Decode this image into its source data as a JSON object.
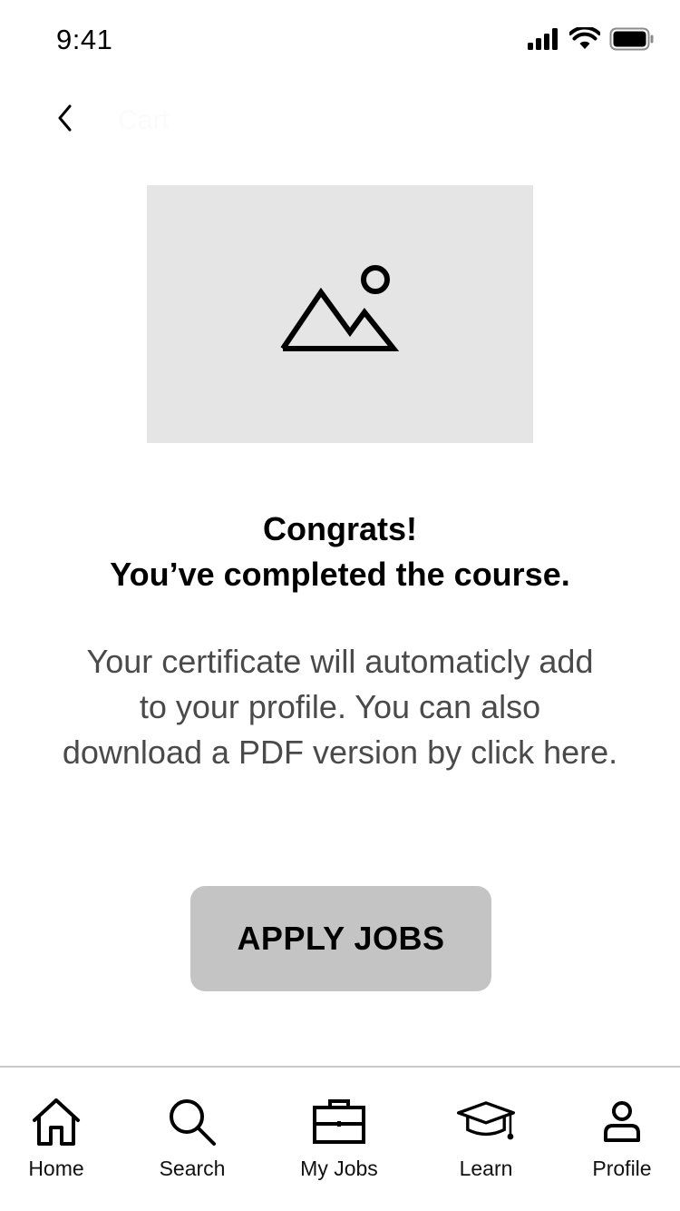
{
  "status_bar": {
    "time": "9:41",
    "icons": [
      "cellular-signal-icon",
      "wifi-icon",
      "battery-icon"
    ]
  },
  "nav": {
    "back_icon": "chevron-left-icon",
    "title": "Cart"
  },
  "hero": {
    "icon": "image-placeholder-icon"
  },
  "content": {
    "headline_line1": "Congrats!",
    "headline_line2": "You’ve completed the course.",
    "body_line1": "Your certificate will automaticly add",
    "body_line2": "to your profile. You can also",
    "body_line3": "download a PDF version by click here."
  },
  "cta": {
    "label": "APPLY JOBS"
  },
  "tab_bar": {
    "items": [
      {
        "label": "Home",
        "icon": "home-icon"
      },
      {
        "label": "Search",
        "icon": "search-icon"
      },
      {
        "label": "My Jobs",
        "icon": "briefcase-icon"
      },
      {
        "label": "Learn",
        "icon": "graduation-cap-icon"
      },
      {
        "label": "Profile",
        "icon": "person-icon"
      }
    ]
  },
  "colors": {
    "background": "#ffffff",
    "placeholder": "#e5e5e5",
    "button": "#c4c4c4",
    "body_text": "#4a4a4a",
    "divider": "#c8c8c8"
  }
}
